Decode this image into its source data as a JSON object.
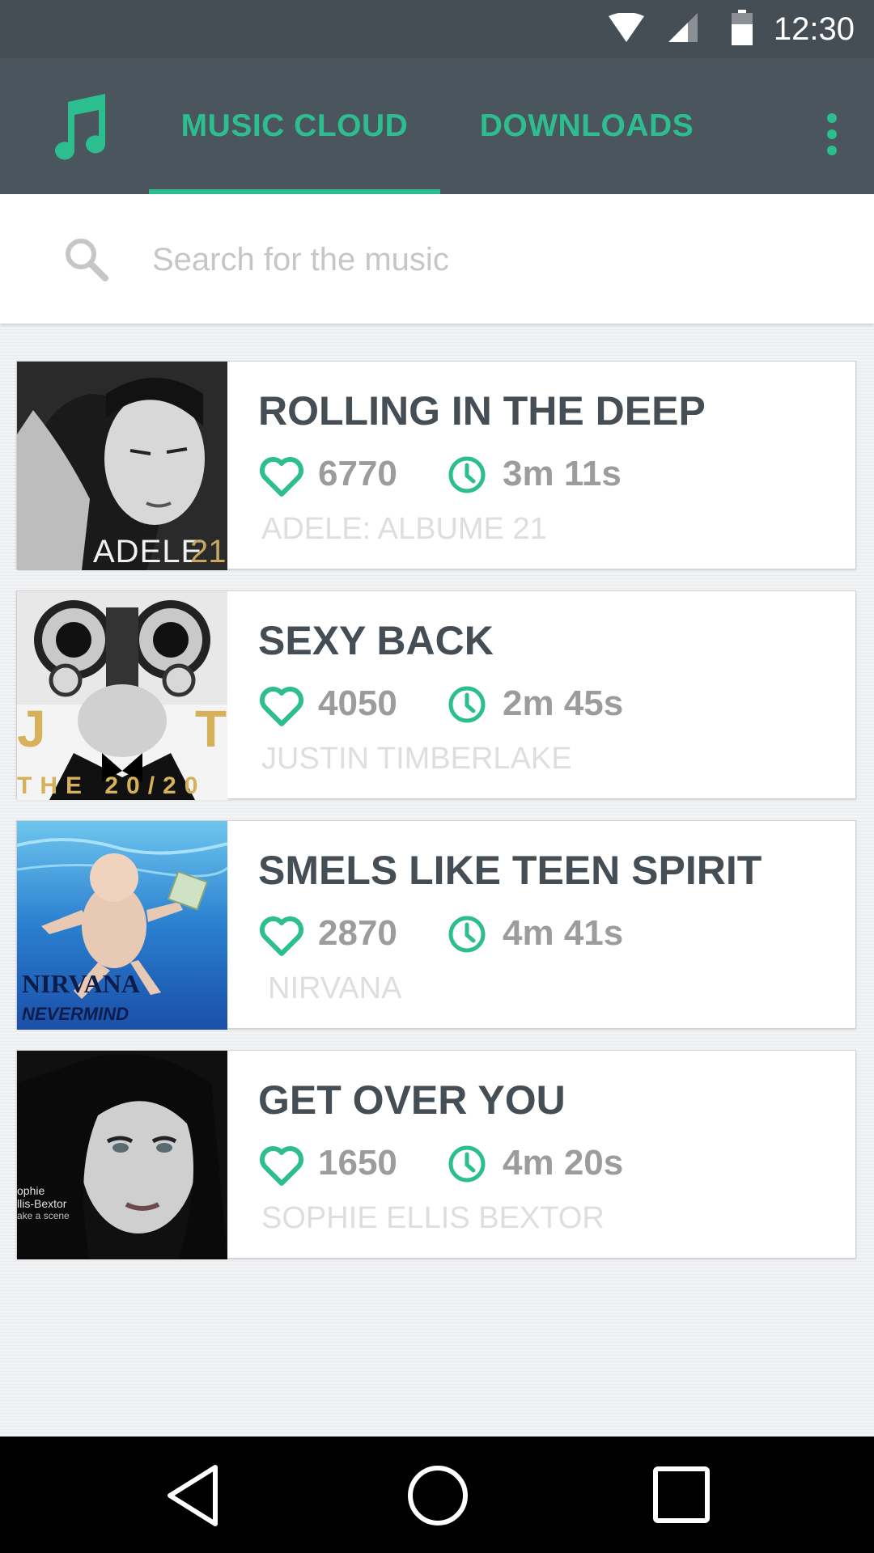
{
  "status_bar": {
    "time": "12:30",
    "icons": [
      "wifi-icon",
      "cell-signal-icon",
      "battery-icon"
    ]
  },
  "app_bar": {
    "logo_icon": "music-note-icon",
    "tabs": [
      {
        "label": "MUSIC CLOUD",
        "active": true
      },
      {
        "label": "DOWNLOADS",
        "active": false
      }
    ],
    "overflow_icon": "more-vert-icon"
  },
  "search": {
    "placeholder": "Search for the music",
    "value": ""
  },
  "songs": [
    {
      "title": "ROLLING IN THE DEEP",
      "likes": "6770",
      "duration": "3m 11s",
      "artist": "ADELE: ALBUME 21",
      "cover_text": "ADELE 21"
    },
    {
      "title": "SEXY BACK",
      "likes": "4050",
      "duration": "2m 45s",
      "artist": "JUSTIN TIMBERLAKE",
      "cover_text": "J T THE 20/20"
    },
    {
      "title": "SMELS LIKE TEEN SPIRIT",
      "likes": "2870",
      "duration": "4m 41s",
      "artist": "NIRVANA",
      "cover_text": "NIRVANA NEVERMIND"
    },
    {
      "title": "GET OVER YOU",
      "likes": "1650",
      "duration": "4m 20s",
      "artist": "SOPHIE ELLIS BEXTOR",
      "cover_text": "ophie llis-Bextor ake a scene"
    }
  ],
  "colors": {
    "accent": "#2dbe8f",
    "app_bar": "#4b555e",
    "status_bar": "#454d55",
    "title_text": "#454d55",
    "stat_text": "#9a9c9e",
    "artist_text": "#dcdee0"
  },
  "nav_bar": {
    "buttons": [
      "back-icon",
      "home-icon",
      "recents-icon"
    ]
  }
}
